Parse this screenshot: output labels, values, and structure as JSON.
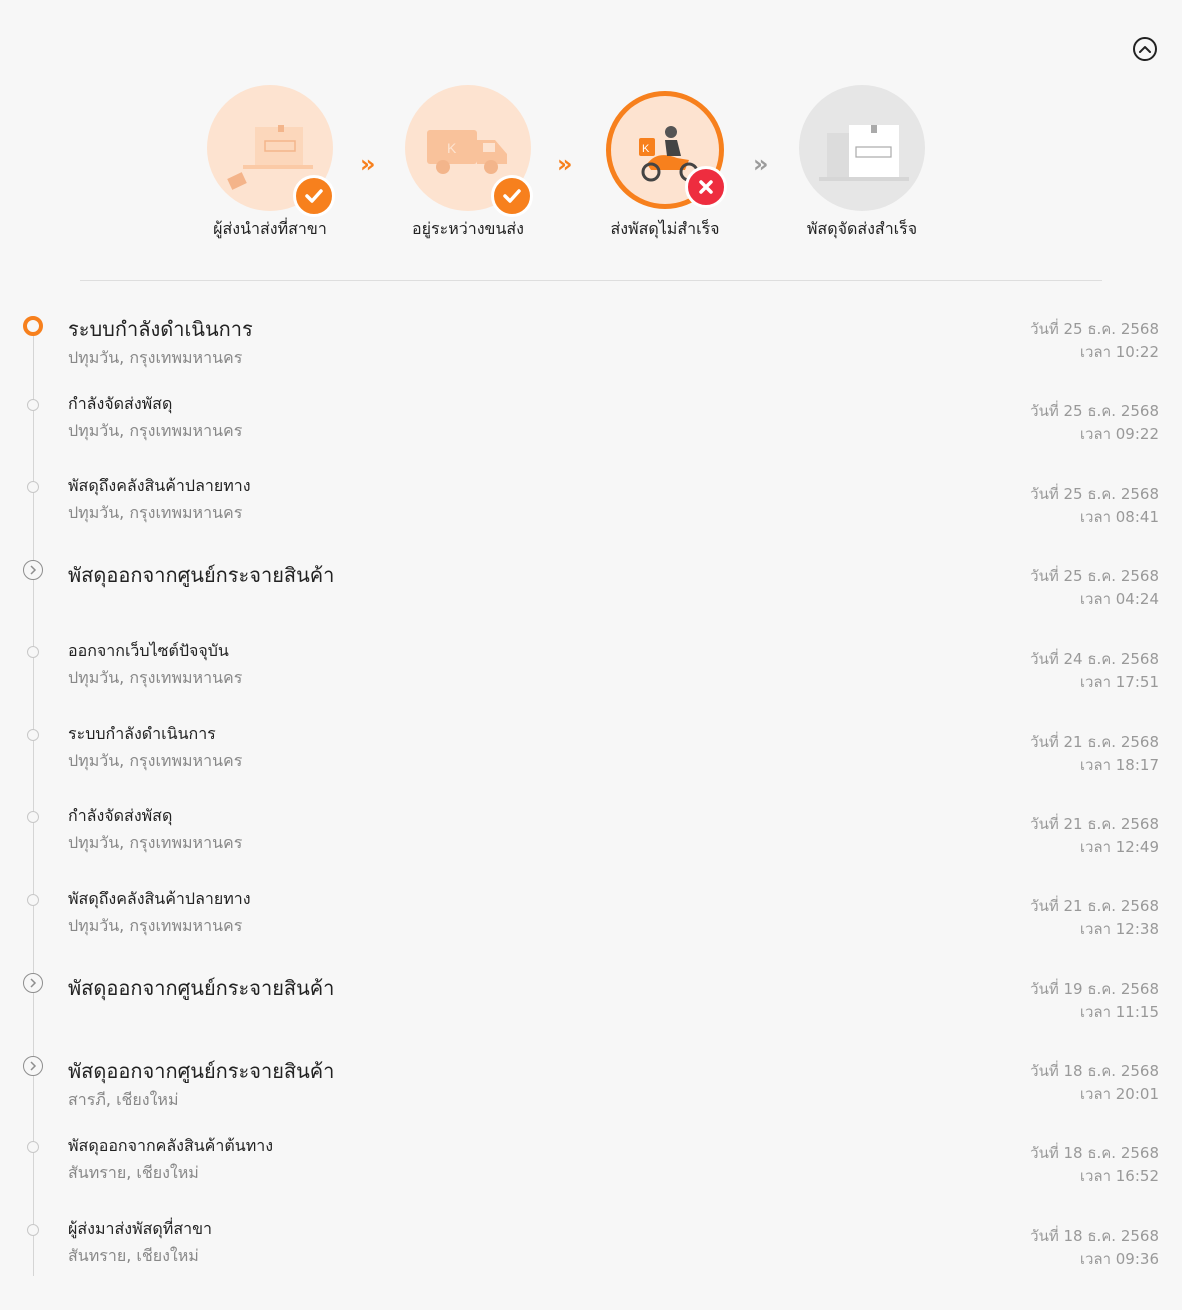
{
  "colors": {
    "accent": "#f7801d",
    "error": "#ee2d3f",
    "arrow_active": "#f7801d",
    "arrow_inactive": "#9b9b9b"
  },
  "header": {
    "collapse_icon": "chevron-up-icon"
  },
  "steps": [
    {
      "label": "ผู้ส่งนำส่งที่สาขา",
      "status": "done",
      "icon": "parcel-dropoff-icon"
    },
    {
      "label": "อยู่ระหว่างขนส่ง",
      "status": "done",
      "icon": "delivery-truck-icon"
    },
    {
      "label": "ส่งพัสดุไม่สำเร็จ",
      "status": "failed",
      "icon": "delivery-scooter-icon"
    },
    {
      "label": "พัสดุจัดส่งสำเร็จ",
      "status": "pending",
      "icon": "parcel-box-icon"
    }
  ],
  "step_arrow": "»",
  "events": [
    {
      "title": "ระบบกำลังดำเนินการ",
      "location": "ปทุมวัน, กรุงเทพมหานคร",
      "date": "วันที่ 25 ธ.ค. 2568",
      "time": "เวลา 10:22",
      "type": "current"
    },
    {
      "title": "กำลังจัดส่งพัสดุ",
      "location": "ปทุมวัน, กรุงเทพมหานคร",
      "date": "วันที่ 25 ธ.ค. 2568",
      "time": "เวลา 09:22",
      "type": "normal"
    },
    {
      "title": "พัสดุถึงคลังสินค้าปลายทาง",
      "location": "ปทุมวัน, กรุงเทพมหานคร",
      "date": "วันที่ 25 ธ.ค. 2568",
      "time": "เวลา 08:41",
      "type": "normal"
    },
    {
      "title": "พัสดุออกจากศูนย์กระจายสินค้า",
      "location": "",
      "date": "วันที่ 25 ธ.ค. 2568",
      "time": "เวลา 04:24",
      "type": "hub"
    },
    {
      "title": "ออกจากเว็บไซต์ปัจจุบัน",
      "location": "ปทุมวัน, กรุงเทพมหานคร",
      "date": "วันที่ 24 ธ.ค. 2568",
      "time": "เวลา 17:51",
      "type": "normal"
    },
    {
      "title": "ระบบกำลังดำเนินการ",
      "location": "ปทุมวัน, กรุงเทพมหานคร",
      "date": "วันที่ 21 ธ.ค. 2568",
      "time": "เวลา 18:17",
      "type": "normal"
    },
    {
      "title": "กำลังจัดส่งพัสดุ",
      "location": "ปทุมวัน, กรุงเทพมหานคร",
      "date": "วันที่ 21 ธ.ค. 2568",
      "time": "เวลา 12:49",
      "type": "normal"
    },
    {
      "title": "พัสดุถึงคลังสินค้าปลายทาง",
      "location": "ปทุมวัน, กรุงเทพมหานคร",
      "date": "วันที่ 21 ธ.ค. 2568",
      "time": "เวลา 12:38",
      "type": "normal"
    },
    {
      "title": "พัสดุออกจากศูนย์กระจายสินค้า",
      "location": "",
      "date": "วันที่ 19 ธ.ค. 2568",
      "time": "เวลา 11:15",
      "type": "hub"
    },
    {
      "title": "พัสดุออกจากศูนย์กระจายสินค้า",
      "location": "สารภี, เชียงใหม่",
      "date": "วันที่ 18 ธ.ค. 2568",
      "time": "เวลา 20:01",
      "type": "hub"
    },
    {
      "title": "พัสดุออกจากคลังสินค้าต้นทาง",
      "location": "สันทราย, เชียงใหม่",
      "date": "วันที่ 18 ธ.ค. 2568",
      "time": "เวลา 16:52",
      "type": "normal"
    },
    {
      "title": "ผู้ส่งมาส่งพัสดุที่สาขา",
      "location": "สันทราย, เชียงใหม่",
      "date": "วันที่ 18 ธ.ค. 2568",
      "time": "เวลา 09:36",
      "type": "normal"
    }
  ]
}
